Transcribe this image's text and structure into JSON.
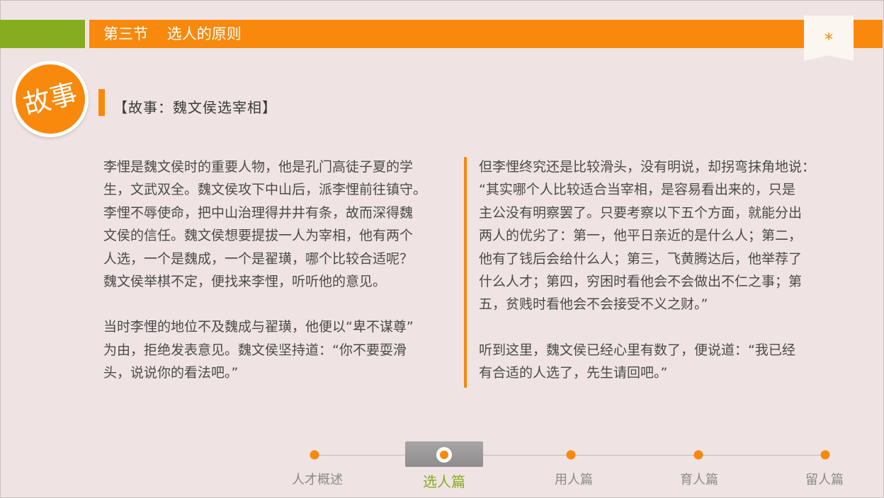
{
  "header": {
    "section_title": "第三节    选人的原则",
    "bookmark_symbol": "*"
  },
  "story": {
    "badge": "故事",
    "heading": "【故事：魏文侯选宰相】"
  },
  "left_column": {
    "para1": [
      "李悝是魏文侯时的重要人物，他是孔门高徒子夏的学",
      "生，文武双全。魏文侯攻下中山后，派李悝前往镇守。",
      "李悝不辱使命，把中山治理得井井有条，故而深得魏",
      "文侯的信任。魏文侯想要提拔一人为宰相，他有两个",
      "人选，一个是魏成，一个是翟璜，哪个比较合适呢？",
      "魏文侯举棋不定，便找来李悝，听听他的意见。"
    ],
    "para2": [
      "当时李悝的地位不及魏成与翟璜，他便以“卑不谋尊”",
      "为由，拒绝发表意见。魏文侯坚持道：“你不要耍滑",
      "头，说说你的看法吧。”"
    ]
  },
  "right_column": {
    "para1": [
      "但李悝终究还是比较滑头，没有明说，却拐弯抹角地说：",
      "“其实哪个人比较适合当宰相，是容易看出来的，只是",
      "主公没有明察罢了。只要考察以下五个方面，就能分出",
      "两人的优劣了：第一，他平日亲近的是什么人；第二，",
      "他有了钱后会给什么人；第三，飞黄腾达后，他举荐了",
      "什么人才；第四，穷困时看他会不会做出不仁之事；第",
      "五，贫贱时看他会不会接受不义之财。”"
    ],
    "para2": [
      "听到这里，魏文侯已经心里有数了，便说道：“我已经",
      "有合适的人选了，先生请回吧。”"
    ]
  },
  "nav": {
    "items": [
      {
        "label": "人才概述",
        "active": false
      },
      {
        "label": "选人篇",
        "active": true
      },
      {
        "label": "用人篇",
        "active": false
      },
      {
        "label": "育人篇",
        "active": false
      },
      {
        "label": "留人篇",
        "active": false
      }
    ]
  },
  "colors": {
    "accent_orange": "#f8890c",
    "accent_green": "#86ac1f",
    "background": "#efe4e3"
  }
}
